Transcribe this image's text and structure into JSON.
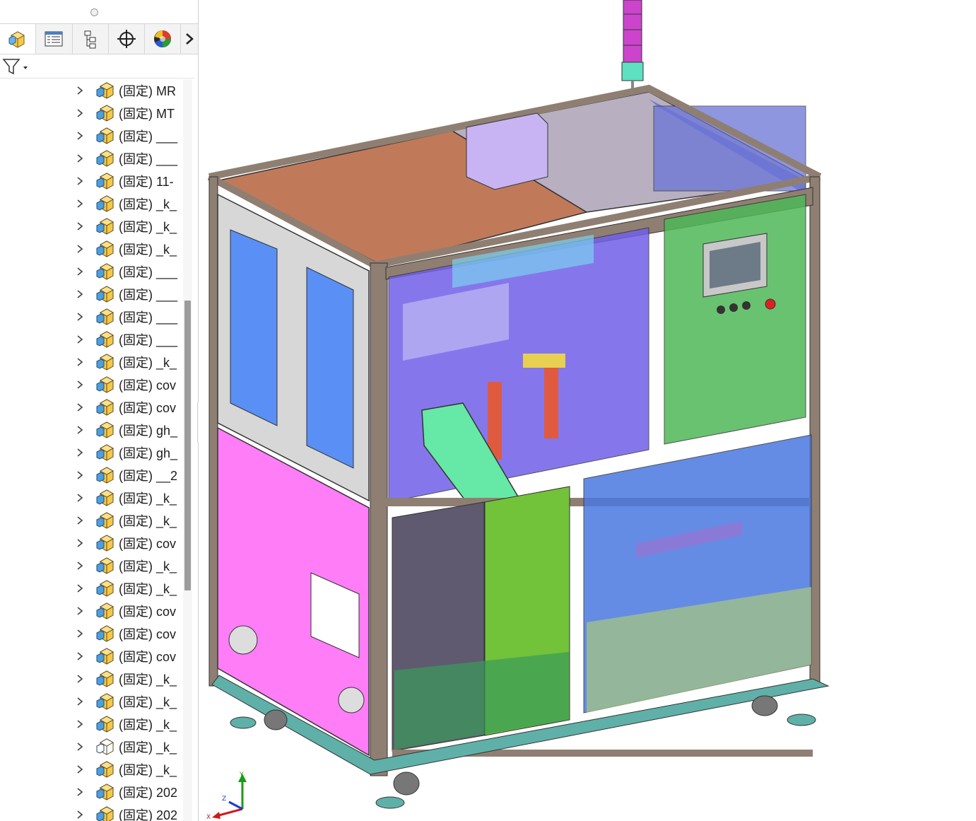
{
  "panel": {
    "tabs": [
      {
        "name": "feature-manager",
        "icon": "assembly-icon"
      },
      {
        "name": "property-manager",
        "icon": "property-list-icon"
      },
      {
        "name": "configuration-manager",
        "icon": "configuration-icon"
      },
      {
        "name": "dimxpert-manager",
        "icon": "crosshair-icon"
      },
      {
        "name": "display-manager",
        "icon": "appearance-sphere-icon"
      }
    ],
    "more_tabs_icon": "chevron-right-icon",
    "filter_icon": "filter-icon",
    "tree_items": [
      {
        "label": "(固定) MR",
        "icon": "subassembly-icon"
      },
      {
        "label": "(固定) MT",
        "icon": "subassembly-icon"
      },
      {
        "label": "(固定) ___",
        "icon": "subassembly-icon"
      },
      {
        "label": "(固定) ___",
        "icon": "subassembly-icon"
      },
      {
        "label": "(固定) 11-",
        "icon": "subassembly-icon"
      },
      {
        "label": "(固定) _k_",
        "icon": "subassembly-icon"
      },
      {
        "label": "(固定) _k_",
        "icon": "subassembly-icon"
      },
      {
        "label": "(固定) _k_",
        "icon": "subassembly-icon"
      },
      {
        "label": "(固定) ___",
        "icon": "subassembly-icon"
      },
      {
        "label": "(固定) ___",
        "icon": "subassembly-icon"
      },
      {
        "label": "(固定) ___",
        "icon": "subassembly-icon"
      },
      {
        "label": "(固定) ___",
        "icon": "subassembly-icon"
      },
      {
        "label": "(固定) _k_",
        "icon": "subassembly-icon"
      },
      {
        "label": "(固定) cov",
        "icon": "subassembly-icon"
      },
      {
        "label": "(固定) cov",
        "icon": "subassembly-icon"
      },
      {
        "label": "(固定) gh_",
        "icon": "subassembly-icon"
      },
      {
        "label": "(固定) gh_",
        "icon": "subassembly-icon"
      },
      {
        "label": "(固定) __2",
        "icon": "subassembly-icon"
      },
      {
        "label": "(固定) _k_",
        "icon": "subassembly-icon"
      },
      {
        "label": "(固定) _k_",
        "icon": "subassembly-icon"
      },
      {
        "label": "(固定) cov",
        "icon": "subassembly-icon"
      },
      {
        "label": "(固定) _k_",
        "icon": "subassembly-icon"
      },
      {
        "label": "(固定) _k_",
        "icon": "subassembly-icon"
      },
      {
        "label": "(固定) cov",
        "icon": "subassembly-icon"
      },
      {
        "label": "(固定) cov",
        "icon": "subassembly-icon"
      },
      {
        "label": "(固定) cov",
        "icon": "subassembly-icon"
      },
      {
        "label": "(固定) _k_",
        "icon": "subassembly-icon"
      },
      {
        "label": "(固定) _k_",
        "icon": "subassembly-icon"
      },
      {
        "label": "(固定) _k_",
        "icon": "subassembly-icon"
      },
      {
        "label": "(固定) _k_",
        "icon": "suppressed-subassembly-icon"
      },
      {
        "label": "(固定) _k_",
        "icon": "subassembly-icon"
      },
      {
        "label": "(固定) 202",
        "icon": "subassembly-icon"
      },
      {
        "label": "(固定) 202",
        "icon": "subassembly-icon"
      }
    ]
  },
  "viewport": {
    "model_icon": "machine-assembly-model",
    "triad": {
      "x": "X",
      "y": "Y",
      "z": "Z"
    }
  },
  "colors": {
    "frame": "#8f7f72",
    "top_left_panel": "#c07a5a",
    "top_right_panel": "#b8b0c0",
    "side_upper": "#d7d7d7",
    "side_window": "#5a8ff5",
    "side_lower": "#ff7df7",
    "front_upper_left": "#7060e8",
    "front_upper_right": "#4fb858",
    "front_lower_left": "#5f5a70",
    "front_lower_mid": "#72c23a",
    "front_lower_right": "#4a78e0",
    "chute": "#66e8a6",
    "signal_tower": "#cc44cc",
    "tree_icon_fill": "#f5c84a",
    "tree_icon_accent": "#4aa0e0"
  }
}
